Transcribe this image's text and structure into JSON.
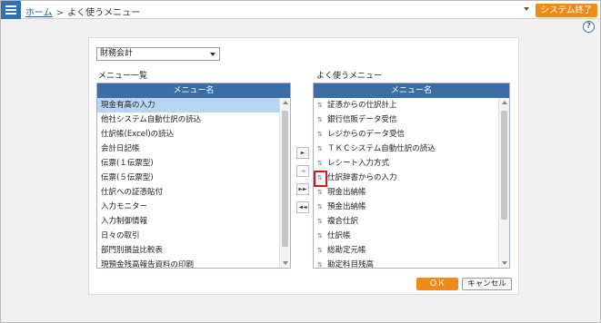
{
  "header": {
    "home_label": "ホーム",
    "separator": ">",
    "current_page": "よく使うメニュー",
    "exit_button": "システム終了"
  },
  "help_label": "?",
  "category_select": {
    "value": "財務会計"
  },
  "left_list": {
    "title": "メニュー一覧",
    "column_header": "メニュー名",
    "items": [
      "現金有高の入力",
      "他社システム自動仕訳の読込",
      "仕訳帳(Excel)の読込",
      "会計日記帳",
      "伝票(１伝票型)",
      "伝票(５伝票型)",
      "仕訳への証憑貼付",
      "入力モニター",
      "入力制御情報",
      "日々の取引",
      "部門別損益比較表",
      "現預金残高報告資料の印刷"
    ],
    "selected_index": 0
  },
  "right_list": {
    "title": "よく使うメニュー",
    "column_header": "メニュー名",
    "items": [
      "証憑からの仕訳計上",
      "銀行信販データ受信",
      "レジからのデータ受信",
      "ＴＫＣシステム自動仕訳の読込",
      "レシート入力方式",
      "仕訳辞書からの入力",
      "現金出納帳",
      "預金出納帳",
      "複合仕訳",
      "仕訳帳",
      "総勘定元帳",
      "勘定科目残高"
    ]
  },
  "transfer_buttons": {
    "add": "►",
    "remove": "◄",
    "add_all": "►►",
    "remove_all": "◄◄"
  },
  "drag_handle_glyph": "⇅",
  "footer": {
    "ok_button": "ＯＫ",
    "cancel_button": "キャンセル"
  },
  "colors": {
    "accent_orange": "#f08a1a",
    "header_blue": "#3a6ea5",
    "selection_blue": "#b8d6f3",
    "highlight_red": "#e0141a"
  }
}
